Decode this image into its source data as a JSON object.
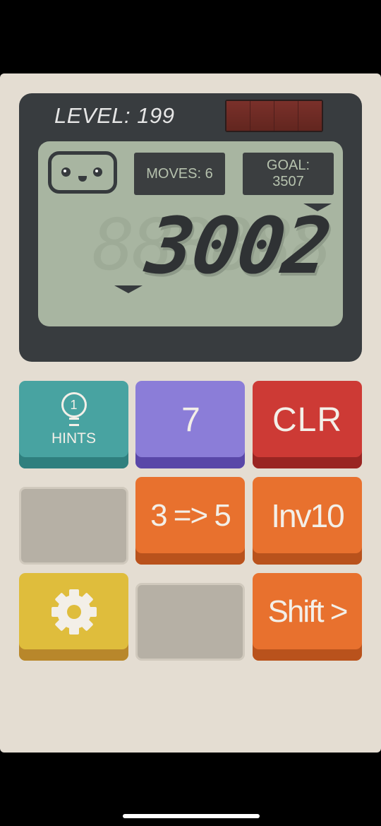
{
  "header": {
    "level_label": "LEVEL: 199"
  },
  "display": {
    "moves_label": "MOVES: 6",
    "goal_label": "GOAL:",
    "goal_value": "3507",
    "ghost_digits": "888888",
    "value": "3002"
  },
  "buttons": {
    "hints_count": "1",
    "hints_label": "HINTS",
    "append_7": "7",
    "clear": "CLR",
    "replace_3_5": "3 => 5",
    "inv10": "Inv10",
    "shift_right": "Shift >"
  },
  "colors": {
    "body": "#e4ddd2",
    "screen": "#383c3f",
    "lcd": "#a8b5a1",
    "teal": "#48a3a1",
    "purple": "#8b7dd8",
    "red": "#cd3a35",
    "orange": "#e8712e",
    "yellow": "#dfbd3c",
    "blank": "#b6b0a5"
  },
  "icons": [
    "lightbulb-icon",
    "gear-icon",
    "robot-face-icon",
    "solar-panel-icon",
    "arrow-down-icon"
  ]
}
